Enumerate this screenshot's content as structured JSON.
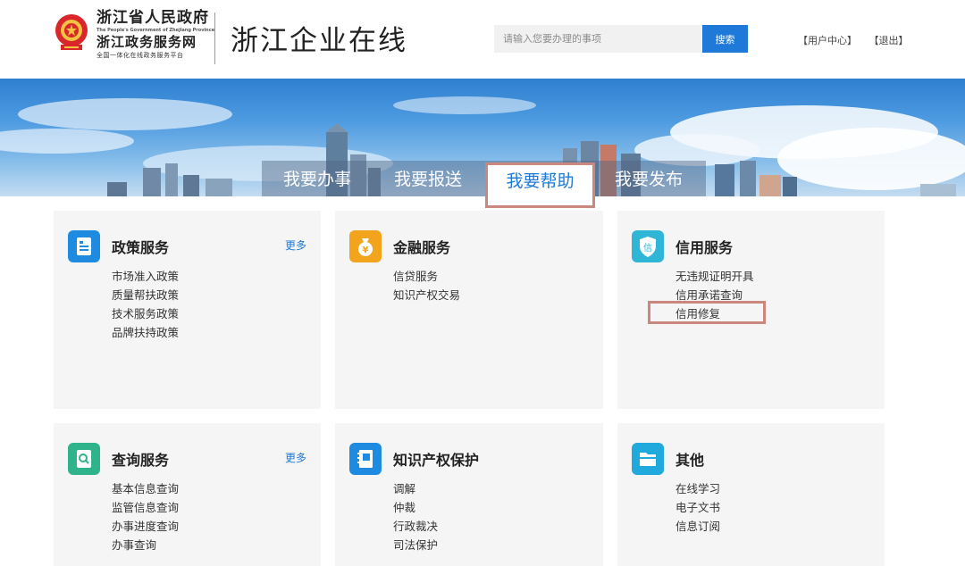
{
  "header": {
    "gov_line1": "浙江省人民政府",
    "gov_line_en": "The People's Government of Zhejiang Province",
    "gov_line2": "浙江政务服务网",
    "gov_line3": "全国一体化在线政务服务平台",
    "site_title": "浙江企业在线",
    "search_placeholder": "请输入您要办理的事项",
    "search_button": "搜索",
    "user_center": "【用户中心】",
    "logout": "【退出】"
  },
  "tabs": [
    {
      "label": "我要办事"
    },
    {
      "label": "我要报送"
    },
    {
      "label": "我要帮助",
      "active": true
    },
    {
      "label": "我要发布"
    }
  ],
  "cards": [
    {
      "title": "政策服务",
      "more": "更多",
      "icon": "document-icon",
      "color": "#1f8be0",
      "items": [
        "市场准入政策",
        "质量帮扶政策",
        "技术服务政策",
        "品牌扶持政策"
      ]
    },
    {
      "title": "金融服务",
      "icon": "money-bag-icon",
      "color": "#f2a41c",
      "items": [
        "信贷服务",
        "知识产权交易"
      ]
    },
    {
      "title": "信用服务",
      "icon": "credit-shield-icon",
      "color": "#2fb6d6",
      "icon_char": "信",
      "items": [
        "无违规证明开具",
        "信用承诺查询",
        "信用修复"
      ]
    },
    {
      "title": "查询服务",
      "more": "更多",
      "icon": "search-doc-icon",
      "color": "#2fb38a",
      "items": [
        "基本信息查询",
        "监管信息查询",
        "办事进度查询",
        "办事查询"
      ]
    },
    {
      "title": "知识产权保护",
      "icon": "notebook-icon",
      "color": "#1f8be0",
      "items": [
        "调解",
        "仲裁",
        "行政裁决",
        "司法保护"
      ]
    },
    {
      "title": "其他",
      "icon": "folder-icon",
      "color": "#1fa9dc",
      "items": [
        "在线学习",
        "电子文书",
        "信息订阅"
      ]
    }
  ]
}
